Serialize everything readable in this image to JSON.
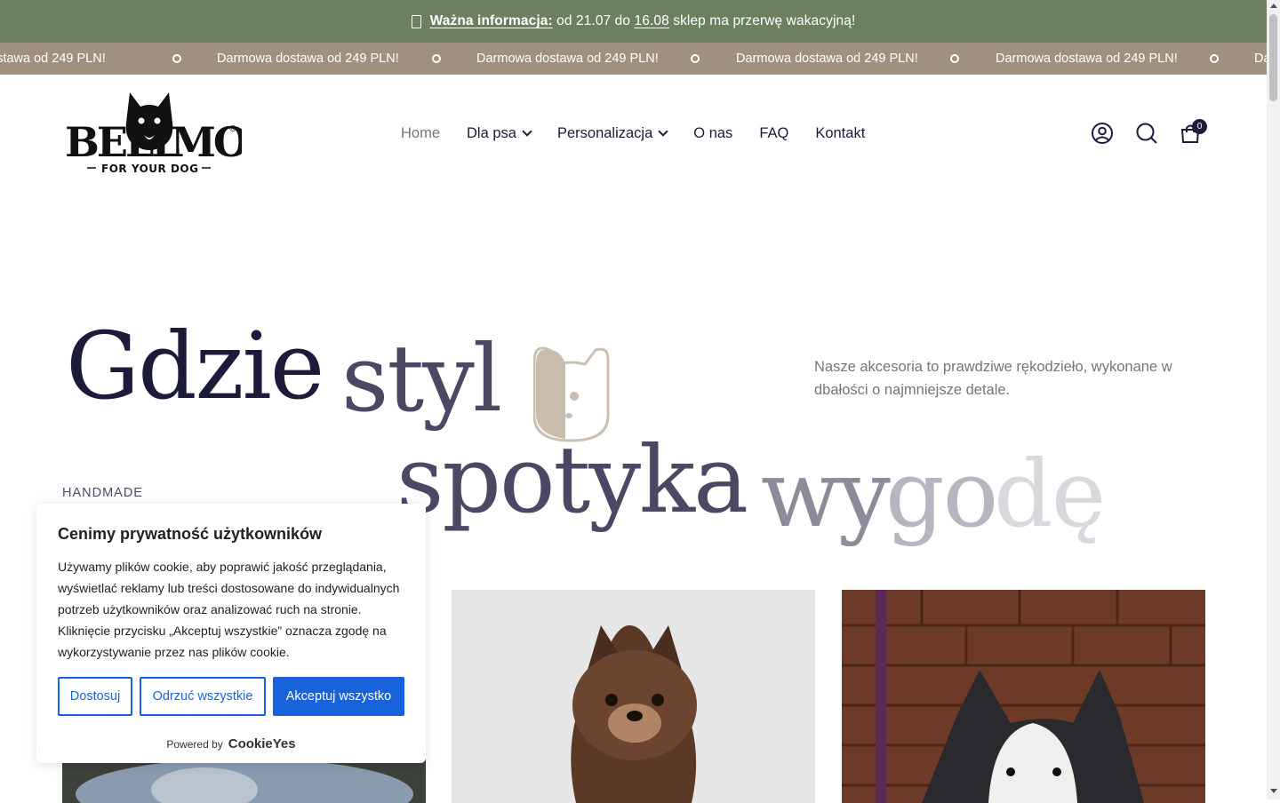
{
  "announcement": {
    "label": "Ważna informacja:",
    "text_1": " od 21.07 do ",
    "date_2": "16.08",
    "text_2": " sklep ma przerwę wakacyjną!"
  },
  "marquee": {
    "text": "Darmowa dostawa od 249 PLN!"
  },
  "nav": {
    "items": [
      {
        "label": "Home"
      },
      {
        "label": "Dla psa"
      },
      {
        "label": "Personalizacja"
      },
      {
        "label": "O nas"
      },
      {
        "label": "FAQ"
      },
      {
        "label": "Kontakt"
      }
    ]
  },
  "header": {
    "cart_count": "0",
    "logo_text": "BELLOMO",
    "logo_tagline": "FOR YOUR DOG"
  },
  "hero": {
    "word1": "Gdzie",
    "word2": "styl",
    "word3": "spotyka",
    "word4": "wy",
    "word5": "go",
    "word6": "dę",
    "subtitle": "Nasze akcesoria to prawdziwe rękodzieło, wykonane w dbałości o najmniejsze detale.",
    "tag": "HANDMADE"
  },
  "cookie": {
    "title": "Cenimy prywatność użytkowników",
    "body": "Używamy plików cookie, aby poprawić jakość przeglądania, wyświetlać reklamy lub treści dostosowane do indywidualnych potrzeb użytkowników oraz analizować ruch na stronie. Kliknięcie przycisku „Akceptuj wszystkie” oznacza zgodę na wykorzystywanie przez nas plików cookie.",
    "btn_customize": "Dostosuj",
    "btn_reject": "Odrzuć wszystkie",
    "btn_accept": "Akceptuj wszystko",
    "powered_by": "Powered by",
    "brand": "CookieYes"
  },
  "colors": {
    "announcement_bg": "#6b8060",
    "marquee_bg": "#a09080",
    "primary_text": "#1d1b3a",
    "cookie_blue": "#1863dc"
  }
}
